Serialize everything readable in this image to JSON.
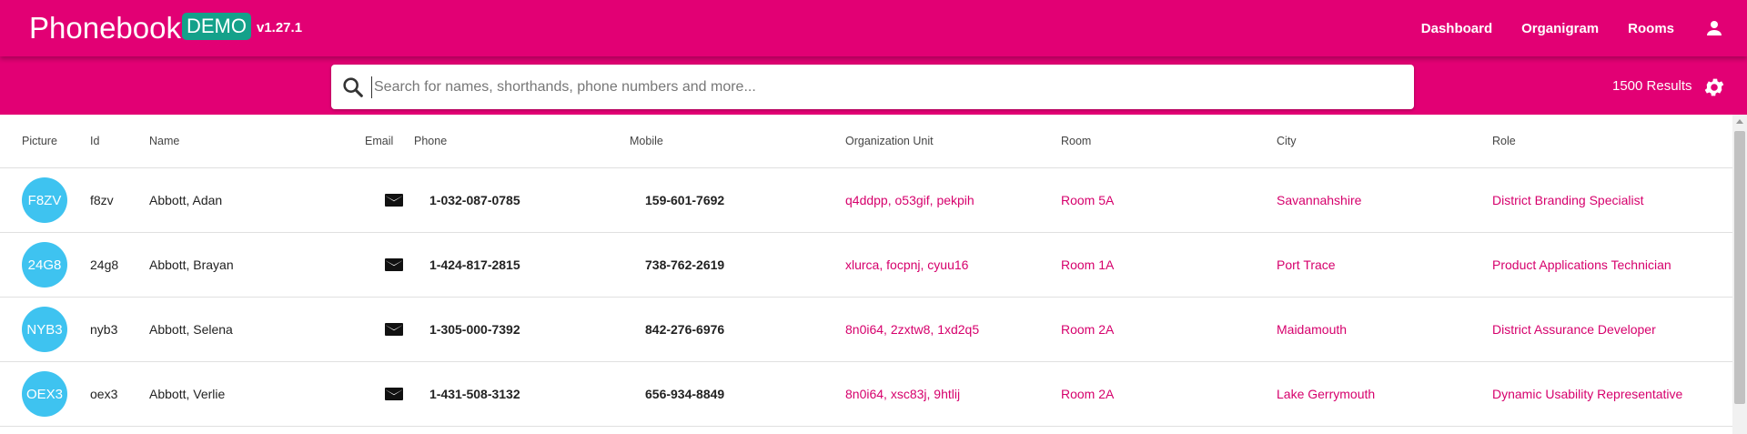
{
  "header": {
    "title": "Phonebook",
    "badge": "DEMO",
    "version": "v1.27.1",
    "nav": [
      "Dashboard",
      "Organigram",
      "Rooms"
    ],
    "user_icon": "account-icon",
    "brand_color": "#e20074"
  },
  "search": {
    "placeholder": "Search for names, shorthands, phone numbers and more...",
    "value": "",
    "results": "1500 Results",
    "settings_icon": "gear-icon"
  },
  "table": {
    "columns": [
      "Picture",
      "Id",
      "Name",
      "Email",
      "Phone",
      "Mobile",
      "Organization Unit",
      "Room",
      "City",
      "Role"
    ],
    "avatar_color": "#3ec3f0",
    "link_color": "#d6006c",
    "rows": [
      {
        "initials": "F8ZV",
        "id": "f8zv",
        "name": "Abbott, Adan",
        "phone": "1-032-087-0785",
        "mobile": "159-601-7692",
        "org": [
          "q4ddpp",
          "o53gif",
          "pekpih"
        ],
        "room": "Room 5A",
        "city": "Savannahshire",
        "role": "District Branding Specialist"
      },
      {
        "initials": "24G8",
        "id": "24g8",
        "name": "Abbott, Brayan",
        "phone": "1-424-817-2815",
        "mobile": "738-762-2619",
        "org": [
          "xlurca",
          "focpnj",
          "cyuu16"
        ],
        "room": "Room 1A",
        "city": "Port Trace",
        "role": "Product Applications Technician"
      },
      {
        "initials": "NYB3",
        "id": "nyb3",
        "name": "Abbott, Selena",
        "phone": "1-305-000-7392",
        "mobile": "842-276-6976",
        "org": [
          "8n0i64",
          "2zxtw8",
          "1xd2q5"
        ],
        "room": "Room 2A",
        "city": "Maidamouth",
        "role": "District Assurance Developer"
      },
      {
        "initials": "OEX3",
        "id": "oex3",
        "name": "Abbott, Verlie",
        "phone": "1-431-508-3132",
        "mobile": "656-934-8849",
        "org": [
          "8n0i64",
          "xsc83j",
          "9htlij"
        ],
        "room": "Room 2A",
        "city": "Lake Gerrymouth",
        "role": "Dynamic Usability Representative"
      }
    ]
  }
}
